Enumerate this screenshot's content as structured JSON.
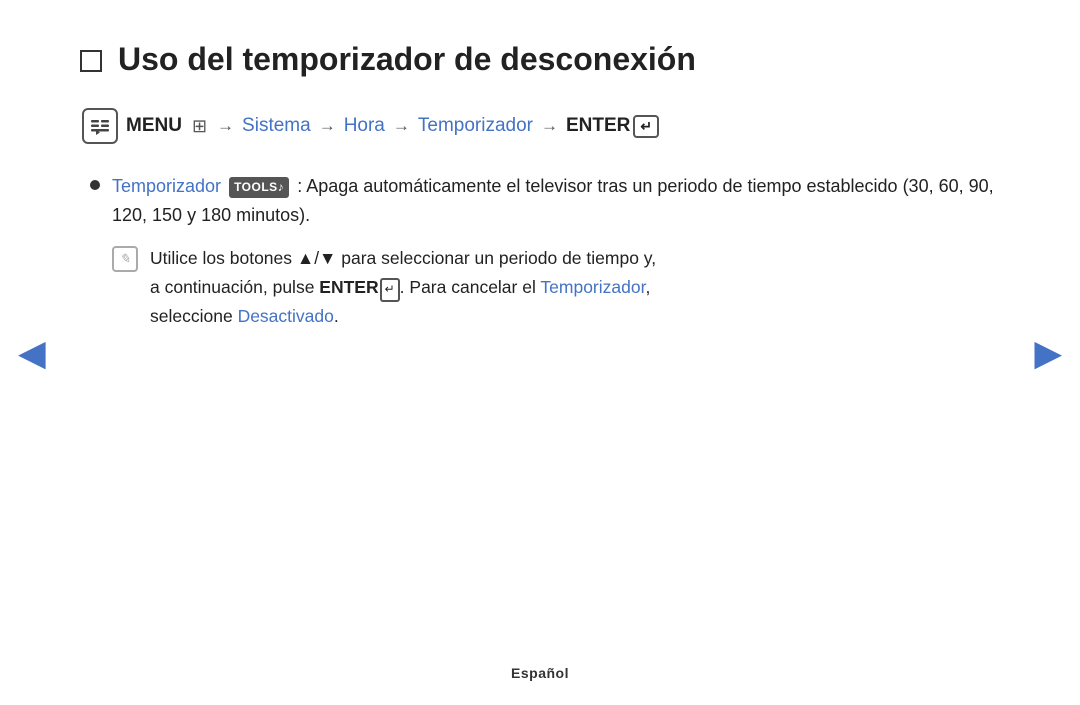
{
  "title": "Uso del temporizador de desconexión",
  "menu_path": {
    "menu_icon": "☰",
    "menu_label": "MENU",
    "sistema": "Sistema",
    "hora": "Hora",
    "temporizador": "Temporizador",
    "enter_label": "ENTER",
    "arrow": "→"
  },
  "bullet": {
    "link_text": "Temporizador",
    "tools_text": "TOOLS♪",
    "description": ": Apaga automáticamente el televisor tras un periodo de tiempo establecido (30, 60, 90, 120, 150 y 180 minutos)."
  },
  "note": {
    "icon": "Ø",
    "line1_pre": "Utilice los botones ▲/▼ para seleccionar un periodo de tiempo y,",
    "line2_pre": "a continuación, pulse ",
    "line2_enter": "ENTER",
    "line2_mid": ". Para cancelar el ",
    "line2_link": "Temporizador",
    "line2_end": ",",
    "line3_pre": "seleccione ",
    "line3_link": "Desactivado",
    "line3_end": "."
  },
  "nav": {
    "left_arrow": "◀",
    "right_arrow": "▶"
  },
  "footer": {
    "language": "Español"
  },
  "colors": {
    "blue_link": "#4472C4",
    "text_dark": "#222222"
  }
}
